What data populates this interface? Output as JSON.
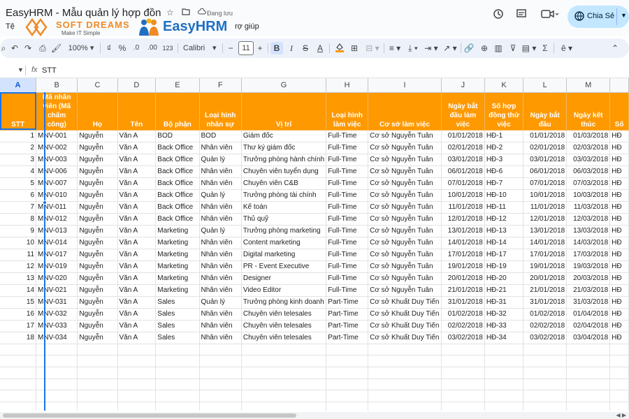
{
  "window": {
    "doc_title": "EasyHRM - Mẫu quản lý hợp đồng nhân sự",
    "saving_status": "Đang lưu",
    "menu_left": "Tệ",
    "menu_right": "rợ giúp"
  },
  "logos": {
    "softdreams_name": "SOFT DREAMS",
    "softdreams_slogan": "Make IT Simple",
    "easyhrm_name": "EasyHRM"
  },
  "share": {
    "label": "Chia Sẻ"
  },
  "toolbar": {
    "zoom": "100%",
    "currency": "₫",
    "percent": "%",
    "dec_decrease": ".0",
    "dec_increase": ".00",
    "number_format": "123",
    "font": "Calibri",
    "font_size": "11"
  },
  "formula_bar": {
    "value": "STT"
  },
  "columns": [
    "A",
    "B",
    "C",
    "D",
    "E",
    "F",
    "G",
    "H",
    "I",
    "J",
    "K",
    "L",
    "M",
    ""
  ],
  "headers": [
    "STT",
    "Mã nhân viên (Mã chấm công)",
    "Họ",
    "Tên",
    "Bộ phận",
    "Loại hình nhân sự",
    "Vị trí",
    "Loại hình làm việc",
    "Cơ sở làm việc",
    "Ngày bắt đầu làm việc",
    "Số hợp đồng thử việc",
    "Ngày bắt đầu",
    "Ngày kết thúc",
    "Số"
  ],
  "rows": [
    [
      "1",
      "MNV-001",
      "Nguyễn",
      "Văn A",
      "BOD",
      "BOD",
      "Giám đốc",
      "Full-Time",
      "Cơ sở Nguyễn Tuân",
      "01/01/2018",
      "HĐ-1",
      "01/01/2018",
      "01/03/2018",
      "HĐ"
    ],
    [
      "2",
      "MNV-002",
      "Nguyễn",
      "Văn A",
      "Back Office",
      "Nhân viên",
      "Thư ký giám đốc",
      "Full-Time",
      "Cơ sở Nguyễn Tuân",
      "02/01/2018",
      "HĐ-2",
      "02/01/2018",
      "02/03/2018",
      "HĐ"
    ],
    [
      "3",
      "MNV-003",
      "Nguyễn",
      "Văn A",
      "Back Office",
      "Quản lý",
      "Trưởng phòng hành chính",
      "Full-Time",
      "Cơ sở Nguyễn Tuân",
      "03/01/2018",
      "HĐ-3",
      "03/01/2018",
      "03/03/2018",
      "HĐ"
    ],
    [
      "4",
      "MNV-006",
      "Nguyễn",
      "Văn A",
      "Back Office",
      "Nhân viên",
      "Chuyên viên tuyển dụng",
      "Full-Time",
      "Cơ sở Nguyễn Tuân",
      "06/01/2018",
      "HĐ-6",
      "06/01/2018",
      "06/03/2018",
      "HĐ"
    ],
    [
      "5",
      "MNV-007",
      "Nguyễn",
      "Văn A",
      "Back Office",
      "Nhân viên",
      "Chuyên viên C&B",
      "Full-Time",
      "Cơ sở Nguyễn Tuân",
      "07/01/2018",
      "HĐ-7",
      "07/01/2018",
      "07/03/2018",
      "HĐ"
    ],
    [
      "6",
      "MNV-010",
      "Nguyễn",
      "Văn A",
      "Back Office",
      "Quản lý",
      "Trưởng phòng tài chính",
      "Full-Time",
      "Cơ sở Nguyễn Tuân",
      "10/01/2018",
      "HĐ-10",
      "10/01/2018",
      "10/03/2018",
      "HĐ"
    ],
    [
      "7",
      "MNV-011",
      "Nguyễn",
      "Văn A",
      "Back Office",
      "Nhân viên",
      "Kế toán",
      "Full-Time",
      "Cơ sở Nguyễn Tuân",
      "11/01/2018",
      "HĐ-11",
      "11/01/2018",
      "11/03/2018",
      "HĐ"
    ],
    [
      "8",
      "MNV-012",
      "Nguyễn",
      "Văn A",
      "Back Office",
      "Nhân viên",
      "Thủ quỹ",
      "Full-Time",
      "Cơ sở Nguyễn Tuân",
      "12/01/2018",
      "HĐ-12",
      "12/01/2018",
      "12/03/2018",
      "HĐ"
    ],
    [
      "9",
      "MNV-013",
      "Nguyễn",
      "Văn A",
      "Marketing",
      "Quản lý",
      "Trưởng phòng marketing",
      "Full-Time",
      "Cơ sở Nguyễn Tuân",
      "13/01/2018",
      "HĐ-13",
      "13/01/2018",
      "13/03/2018",
      "HĐ"
    ],
    [
      "10",
      "MNV-014",
      "Nguyễn",
      "Văn A",
      "Marketing",
      "Nhân viên",
      "Content marketing",
      "Full-Time",
      "Cơ sở Nguyễn Tuân",
      "14/01/2018",
      "HĐ-14",
      "14/01/2018",
      "14/03/2018",
      "HĐ"
    ],
    [
      "11",
      "MNV-017",
      "Nguyễn",
      "Văn A",
      "Marketing",
      "Nhân viên",
      "Digital marketing",
      "Full-Time",
      "Cơ sở Nguyễn Tuân",
      "17/01/2018",
      "HĐ-17",
      "17/01/2018",
      "17/03/2018",
      "HĐ"
    ],
    [
      "12",
      "MNV-019",
      "Nguyễn",
      "Văn A",
      "Marketing",
      "Nhân viên",
      "PR - Event Executive",
      "Full-Time",
      "Cơ sở Nguyễn Tuân",
      "19/01/2018",
      "HĐ-19",
      "19/01/2018",
      "19/03/2018",
      "HĐ"
    ],
    [
      "13",
      "MNV-020",
      "Nguyễn",
      "Văn A",
      "Marketing",
      "Nhân viên",
      "Designer",
      "Full-Time",
      "Cơ sở Nguyễn Tuân",
      "20/01/2018",
      "HĐ-20",
      "20/01/2018",
      "20/03/2018",
      "HĐ"
    ],
    [
      "14",
      "MNV-021",
      "Nguyễn",
      "Văn A",
      "Marketing",
      "Nhân viên",
      "Video Editor",
      "Full-Time",
      "Cơ sở Nguyễn Tuân",
      "21/01/2018",
      "HĐ-21",
      "21/01/2018",
      "21/03/2018",
      "HĐ"
    ],
    [
      "15",
      "MNV-031",
      "Nguyễn",
      "Văn A",
      "Sales",
      "Quản lý",
      "Trưởng phòng kinh doanh",
      "Part-Time",
      "Cơ sở Khuất Duy Tiến",
      "31/01/2018",
      "HĐ-31",
      "31/01/2018",
      "31/03/2018",
      "HĐ"
    ],
    [
      "16",
      "MNV-032",
      "Nguyễn",
      "Văn A",
      "Sales",
      "Nhân viên",
      "Chuyên viên telesales",
      "Part-Time",
      "Cơ sở Khuất Duy Tiến",
      "01/02/2018",
      "HĐ-32",
      "01/02/2018",
      "01/04/2018",
      "HĐ"
    ],
    [
      "17",
      "MNV-033",
      "Nguyễn",
      "Văn A",
      "Sales",
      "Nhân viên",
      "Chuyên viên telesales",
      "Part-Time",
      "Cơ sở Khuất Duy Tiến",
      "02/02/2018",
      "HĐ-33",
      "02/02/2018",
      "02/04/2018",
      "HĐ"
    ],
    [
      "18",
      "MNV-034",
      "Nguyễn",
      "Văn A",
      "Sales",
      "Nhân viên",
      "Chuyên viên telesales",
      "Part-Time",
      "Cơ sở Khuất Duy Tiến",
      "03/02/2018",
      "HĐ-34",
      "03/02/2018",
      "03/04/2018",
      "HĐ"
    ]
  ],
  "colors": {
    "header_fill": "#ff9900",
    "header_text": "#ffffff",
    "share_bg": "#c2e7ff",
    "toolbar_bg": "#edf2fa",
    "selection": "#1a73e8"
  }
}
